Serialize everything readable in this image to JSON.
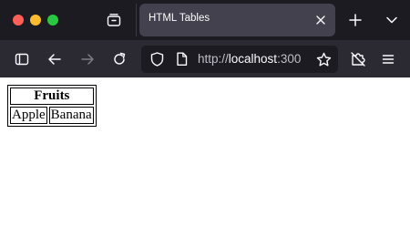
{
  "window": {
    "tab_title": "HTML Tables"
  },
  "navbar": {
    "url_prefix": "http://",
    "url_host": "localhost",
    "url_rest": ":300"
  },
  "icons": [
    "tab-list-icon",
    "close-icon",
    "plus-icon",
    "chevron-down-icon",
    "sidebar-icon",
    "back-arrow-icon",
    "forward-arrow-icon",
    "reload-icon",
    "shield-icon",
    "page-icon",
    "star-icon",
    "extensions-icon",
    "menu-icon"
  ],
  "colors": {
    "titlebar": "#1c1b22",
    "toolbar": "#2b2a33",
    "tab_active": "#42414d",
    "red": "#fe5f57",
    "yellow": "#febc2e",
    "green": "#28c840"
  },
  "table": {
    "header": "Fruits",
    "cells": [
      "Apple",
      "Banana"
    ]
  }
}
